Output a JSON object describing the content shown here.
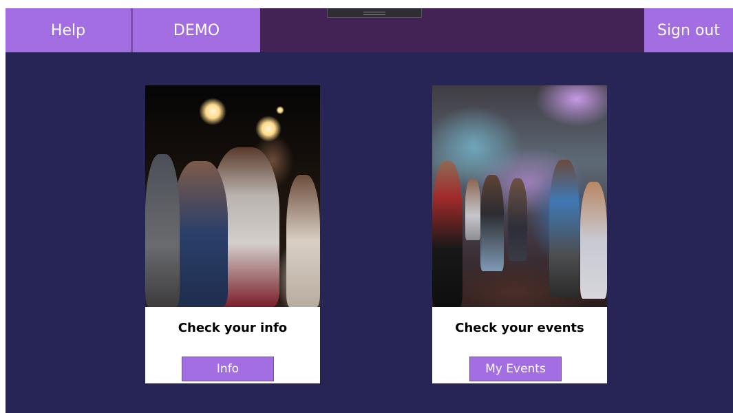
{
  "nav": {
    "help_label": "Help",
    "demo_label": "DEMO",
    "signout_label": "Sign out"
  },
  "cards": [
    {
      "image": "party-sparklers-photo",
      "title": "Check your info",
      "button_label": "Info"
    },
    {
      "image": "dance-floor-photo",
      "title": "Check your events",
      "button_label": "My Events"
    }
  ],
  "colors": {
    "background": "#262556",
    "topbar": "#432255",
    "accent": "#a46ee3",
    "card": "#ffffff",
    "text_dark": "#000000",
    "text_light": "#ffffff"
  }
}
